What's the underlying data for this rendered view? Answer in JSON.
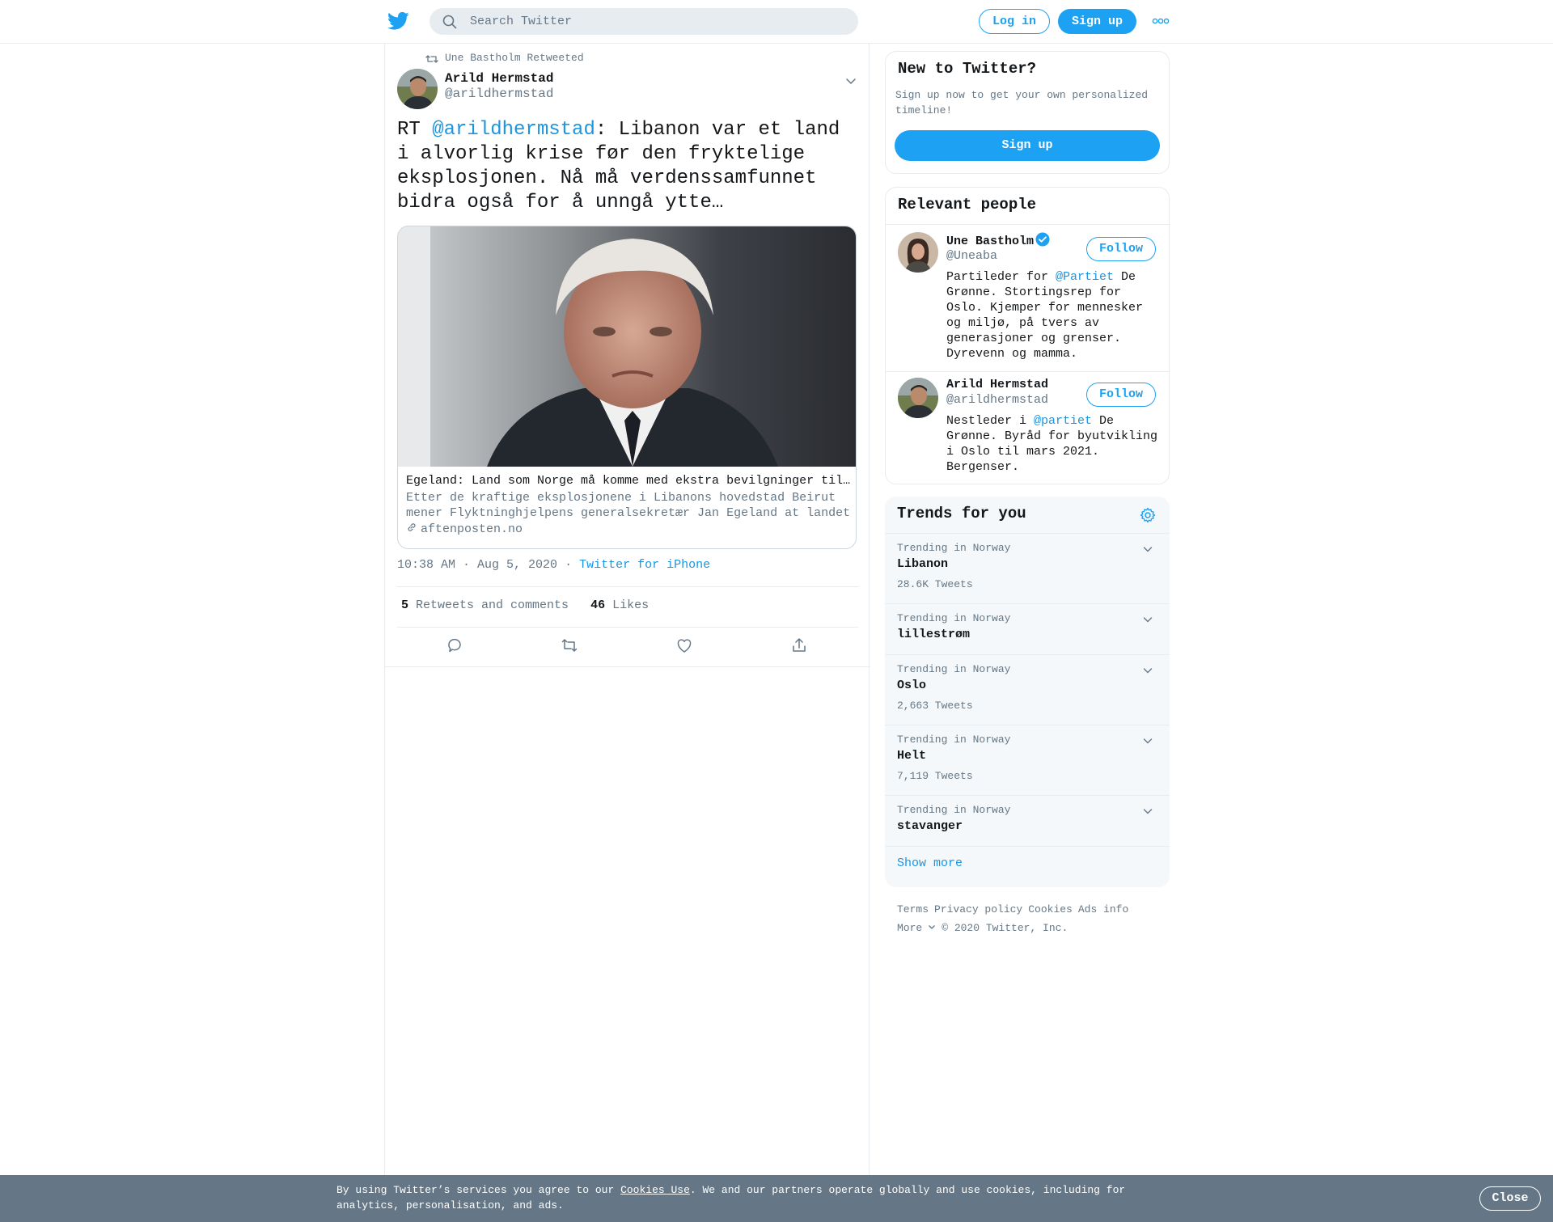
{
  "header": {
    "search_placeholder": "Search Twitter",
    "login_label": "Log in",
    "signup_label": "Sign up",
    "accent": "#1da1f2"
  },
  "tweet": {
    "retweeted_by": "Une Bastholm Retweeted",
    "author_name": "Arild Hermstad",
    "author_handle": "@arildhermstad",
    "text_prefix": "RT ",
    "text_mention": "@arildhermstad",
    "text_body": ": Libanon var et land i alvorlig krise før den fryktelige eksplosjonen. Nå må verdenssamfunnet bidra også for å unngå ytte…",
    "card": {
      "title": "Egeland: Land som Norge må komme med ekstra bevilgninger til Libanon",
      "description": "Etter de kraftige eksplosjonene i Libanons hovedstad Beirut mener Flyktninghjelpens generalsekretær Jan Egeland at landet trenger hjelp",
      "domain": "aftenposten.no"
    },
    "timestamp": "10:38 AM · Aug 5, 2020",
    "separator": "·",
    "source": "Twitter for iPhone",
    "retweets_count": "5",
    "retweets_label": "Retweets and comments",
    "likes_count": "46",
    "likes_label": "Likes"
  },
  "new_to_twitter": {
    "title": "New to Twitter?",
    "description": "Sign up now to get your own personalized timeline!",
    "signup_label": "Sign up"
  },
  "relevant_people": {
    "title": "Relevant people",
    "people": [
      {
        "name": "Une Bastholm",
        "handle": "@Uneaba",
        "follow_label": "Follow",
        "bio_prefix": "Partileder for ",
        "bio_mention": "@Partiet",
        "bio_rest": " De Grønne. Stortingsrep for Oslo. Kjemper for mennesker og miljø, på tvers av generasjoner og grenser. Dyrevenn og mamma."
      },
      {
        "name": "Arild Hermstad",
        "handle": "@arildhermstad",
        "follow_label": "Follow",
        "bio_prefix": "Nestleder i ",
        "bio_mention": "@partiet",
        "bio_rest": " De Grønne. Byråd for byutvikling i Oslo til mars 2021. Bergenser."
      }
    ]
  },
  "trends": {
    "title": "Trends for you",
    "items": [
      {
        "context": "Trending in Norway",
        "name": "Libanon",
        "count": "28.6K Tweets"
      },
      {
        "context": "Trending in Norway",
        "name": "lillestrøm",
        "count": ""
      },
      {
        "context": "Trending in Norway",
        "name": "Oslo",
        "count": "2,663 Tweets"
      },
      {
        "context": "Trending in Norway",
        "name": "Helt",
        "count": "7,119 Tweets"
      },
      {
        "context": "Trending in Norway",
        "name": "stavanger",
        "count": ""
      }
    ],
    "show_more": "Show more"
  },
  "footer": {
    "links": [
      "Terms",
      "Privacy policy",
      "Cookies",
      "Ads info"
    ],
    "more_label": "More",
    "copyright": "© 2020 Twitter, Inc."
  },
  "cookie_bar": {
    "text_before": "By using Twitter’s services you agree to our ",
    "link_text": "Cookies Use",
    "text_after": ". We and our partners operate globally and use cookies, including for analytics, personalisation, and ads.",
    "close_label": "Close"
  }
}
